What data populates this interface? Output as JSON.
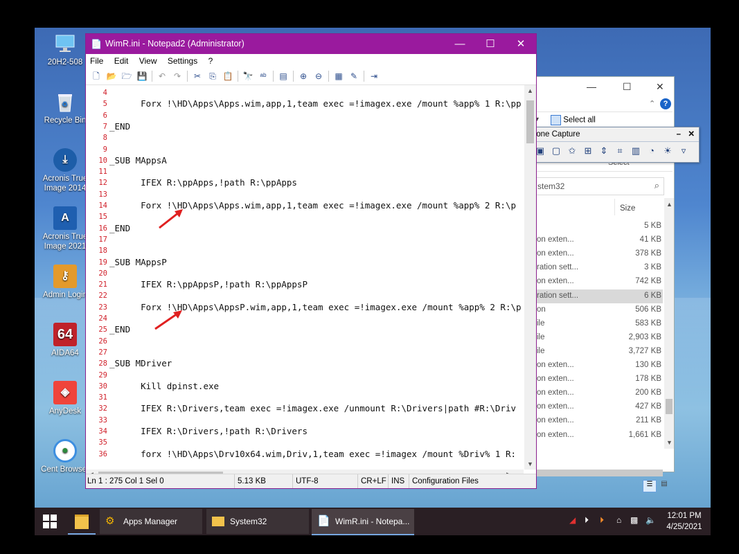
{
  "desktop": {
    "icons": [
      {
        "label": "20H2-508",
        "icon": "computer-icon"
      },
      {
        "label": "Recycle Bin",
        "icon": "recycle-bin-icon"
      },
      {
        "label": "Acronis True Image 2014",
        "icon": "acronis-icon"
      },
      {
        "label": "Acronis True Image 2021",
        "icon": "acronis-a-icon"
      },
      {
        "label": "Admin Login",
        "icon": "key-icon"
      },
      {
        "label": "AIDA64",
        "icon": "aida64-icon",
        "badge": "64"
      },
      {
        "label": "AnyDesk",
        "icon": "anydesk-icon"
      },
      {
        "label": "Cent Browser",
        "icon": "browser-icon"
      }
    ]
  },
  "explorer": {
    "select_all": "Select all",
    "select_group": "Select",
    "address": "stem32",
    "size_header": "Size",
    "rows": [
      {
        "name": "",
        "size": "5 KB"
      },
      {
        "name": "on exten...",
        "size": "41 KB"
      },
      {
        "name": "on exten...",
        "size": "378 KB"
      },
      {
        "name": "ration sett...",
        "size": "3 KB"
      },
      {
        "name": "on exten...",
        "size": "742 KB"
      },
      {
        "name": "ration sett...",
        "size": "6 KB"
      },
      {
        "name": "on",
        "size": "506 KB"
      },
      {
        "name": "ile",
        "size": "583 KB"
      },
      {
        "name": "ile",
        "size": "2,903 KB"
      },
      {
        "name": "ile",
        "size": "3,727 KB"
      },
      {
        "name": "on exten...",
        "size": "130 KB"
      },
      {
        "name": "on exten...",
        "size": "178 KB"
      },
      {
        "name": "on exten...",
        "size": "200 KB"
      },
      {
        "name": "on exten...",
        "size": "427 KB"
      },
      {
        "name": "on exten...",
        "size": "211 KB"
      },
      {
        "name": "on exten...",
        "size": "1,661 KB"
      }
    ]
  },
  "faststone": {
    "title": "FastStone Capture"
  },
  "notepad": {
    "title": "WimR.ini - Notepad2 (Administrator)",
    "menu": [
      "File",
      "Edit",
      "View",
      "Settings",
      "?"
    ],
    "lines": [
      {
        "n": "4",
        "text": ""
      },
      {
        "n": "5",
        "text": "      Forx !\\HD\\Apps\\Apps.wim,app,1,team exec =!imagex.exe /mount %app% 1 R:\\pp"
      },
      {
        "n": "6",
        "text": ""
      },
      {
        "n": "7",
        "text": "_END"
      },
      {
        "n": "8",
        "text": ""
      },
      {
        "n": "9",
        "text": ""
      },
      {
        "n": "10",
        "text": "_SUB MAppsA"
      },
      {
        "n": "11",
        "text": ""
      },
      {
        "n": "12",
        "text": "      IFEX R:\\ppApps,!path R:\\ppApps"
      },
      {
        "n": "13",
        "text": ""
      },
      {
        "n": "14",
        "text": "      Forx !\\HD\\Apps\\Apps.wim,app,1,team exec =!imagex.exe /mount %app% 2 R:\\p"
      },
      {
        "n": "15",
        "text": ""
      },
      {
        "n": "16",
        "text": "_END"
      },
      {
        "n": "17",
        "text": ""
      },
      {
        "n": "18",
        "text": ""
      },
      {
        "n": "19",
        "text": "_SUB MAppsP"
      },
      {
        "n": "20",
        "text": ""
      },
      {
        "n": "21",
        "text": "      IFEX R:\\ppAppsP,!path R:\\ppAppsP"
      },
      {
        "n": "22",
        "text": ""
      },
      {
        "n": "23",
        "text": "      Forx !\\HD\\Apps\\AppsP.wim,app,1,team exec =!imagex.exe /mount %app% 2 R:\\p"
      },
      {
        "n": "24",
        "text": ""
      },
      {
        "n": "25",
        "text": "_END"
      },
      {
        "n": "26",
        "text": ""
      },
      {
        "n": "27",
        "text": ""
      },
      {
        "n": "28",
        "text": "_SUB MDriver"
      },
      {
        "n": "29",
        "text": ""
      },
      {
        "n": "30",
        "text": "      Kill dpinst.exe"
      },
      {
        "n": "31",
        "text": ""
      },
      {
        "n": "32",
        "text": "      IFEX R:\\Drivers,team exec =!imagex.exe /unmount R:\\Drivers|path #R:\\Driv"
      },
      {
        "n": "33",
        "text": ""
      },
      {
        "n": "34",
        "text": "      IFEX R:\\Drivers,!path R:\\Drivers"
      },
      {
        "n": "35",
        "text": ""
      },
      {
        "n": "36",
        "text": "      forx !\\HD\\Apps\\Drv10x64.wim,Driv,1,team exec =!imagex /mount %Driv% 1 R:"
      }
    ],
    "status": {
      "position": "Ln 1 : 275   Col 1   Sel 0",
      "size": "5.13 KB",
      "encoding": "UTF-8",
      "eol": "CR+LF",
      "mode": "INS",
      "scheme": "Configuration Files"
    }
  },
  "taskbar": {
    "tasks": [
      "Apps Manager",
      "System32",
      "WimR.ini - Notepa..."
    ],
    "time": "12:01 PM",
    "date": "4/25/2021"
  },
  "colors": {
    "notepad_title": "#9a1a9e",
    "line_numbers": "#d0202a",
    "arrow": "#e02020"
  }
}
